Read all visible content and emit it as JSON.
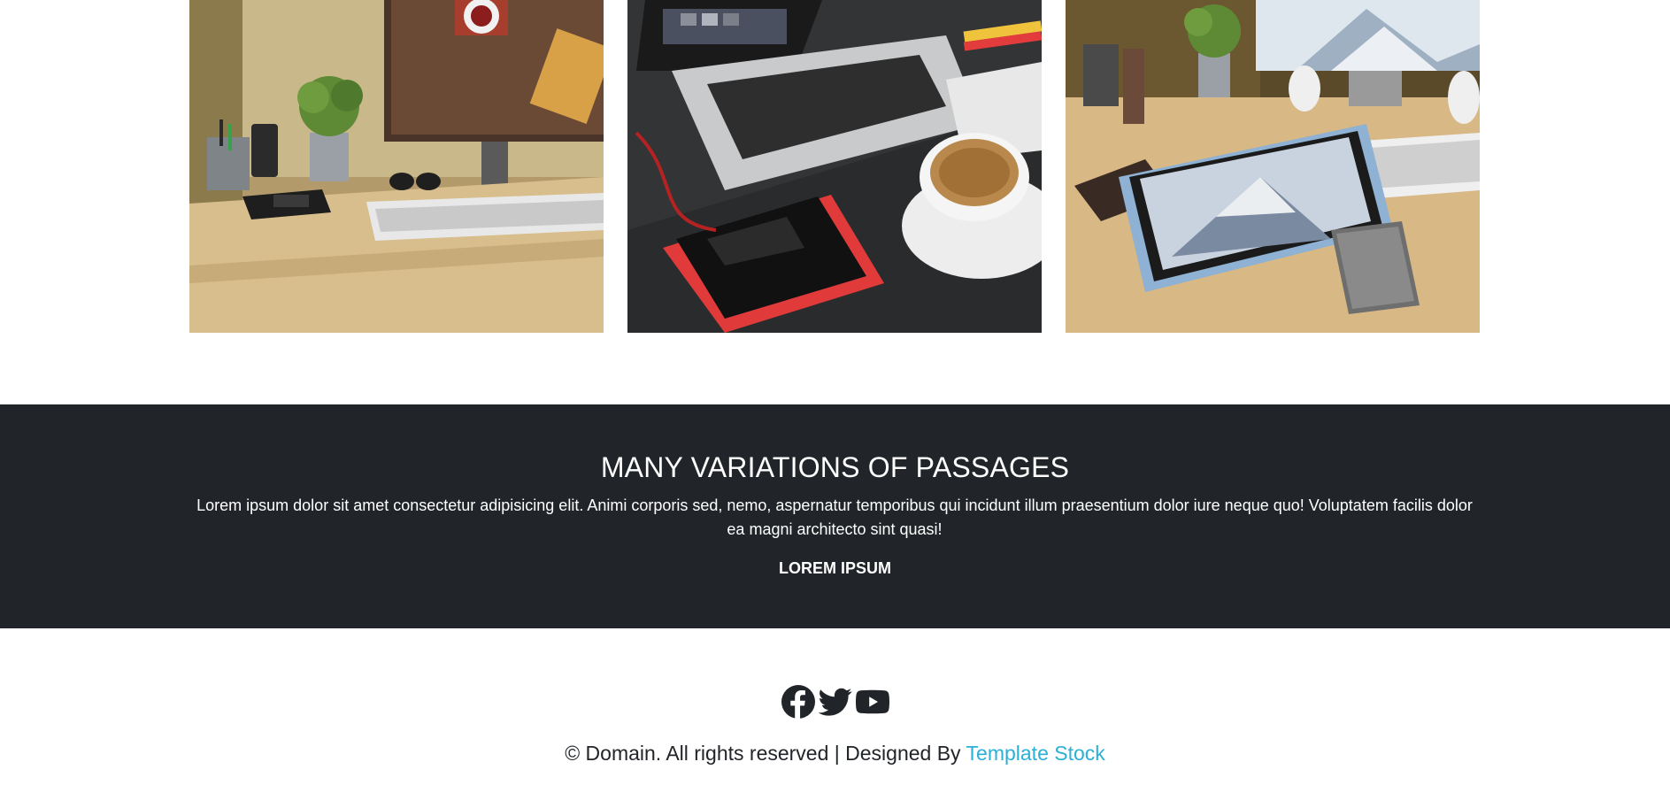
{
  "gallery": {
    "images": [
      {
        "alt": "desk-with-monitor-and-plant"
      },
      {
        "alt": "laptop-coffee-and-phone"
      },
      {
        "alt": "tablet-on-desk"
      }
    ]
  },
  "banner": {
    "title": "MANY VARIATIONS OF PASSAGES",
    "text": "Lorem ipsum dolor sit amet consectetur adipisicing elit. Animi corporis sed, nemo, aspernatur temporibus qui incidunt illum praesentium dolor iure neque quo! Voluptatem facilis dolor ea magni architecto sint quasi!",
    "link_label": "LOREM IPSUM",
    "background": "#212529"
  },
  "footer": {
    "social_icons": [
      "facebook-icon",
      "twitter-icon",
      "youtube-icon"
    ],
    "copyright_prefix": "© Domain. All rights reserved | Designed By ",
    "designer_link": "Template Stock",
    "link_color": "#2bb0d6"
  }
}
